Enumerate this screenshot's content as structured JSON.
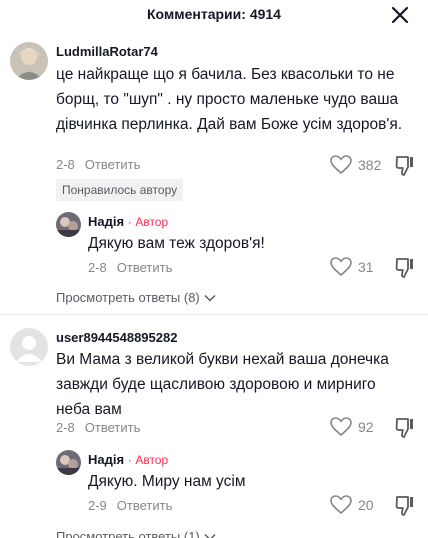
{
  "header": {
    "title": "Комментарии: 4914"
  },
  "comments": [
    {
      "username": "LudmillaRotar74",
      "text": "це найкраще що я бачила. Без квасольки то не борщ, то \"шуп\" . ну просто маленьке чудо ваша дівчинка перлинка. Дай вам Боже усім здоров'я.",
      "date": "2-8",
      "reply_label": "Ответить",
      "likes": "382",
      "badge": "Понравилось автору",
      "reply": {
        "username": "Надія",
        "author_tag": "Автор",
        "separator": "·",
        "text": "Дякую вам теж здоров'я!",
        "date": "2-8",
        "reply_label": "Ответить",
        "likes": "31"
      },
      "view_replies": "Просмотреть ответы (8)"
    },
    {
      "username": "user8944548895282",
      "text": "Ви Мама з великой букви нехай ваша донечка завжди буде щасливою здоровою и мирниго неба вам",
      "date": "2-8",
      "reply_label": "Ответить",
      "likes": "92",
      "reply": {
        "username": "Надія",
        "author_tag": "Автор",
        "separator": "·",
        "text": "Дякую. Миру нам усім",
        "date": "2-9",
        "reply_label": "Ответить",
        "likes": "20"
      },
      "view_replies": "Просмотреть ответы (1)"
    }
  ],
  "icons": {
    "close": "close-icon",
    "like": "heart-icon",
    "dislike": "thumbs-down-icon",
    "chevron": "chevron-down-icon"
  },
  "colors": {
    "author_tag": "#fe2c55",
    "meta": "#86878b",
    "text": "#161823"
  }
}
